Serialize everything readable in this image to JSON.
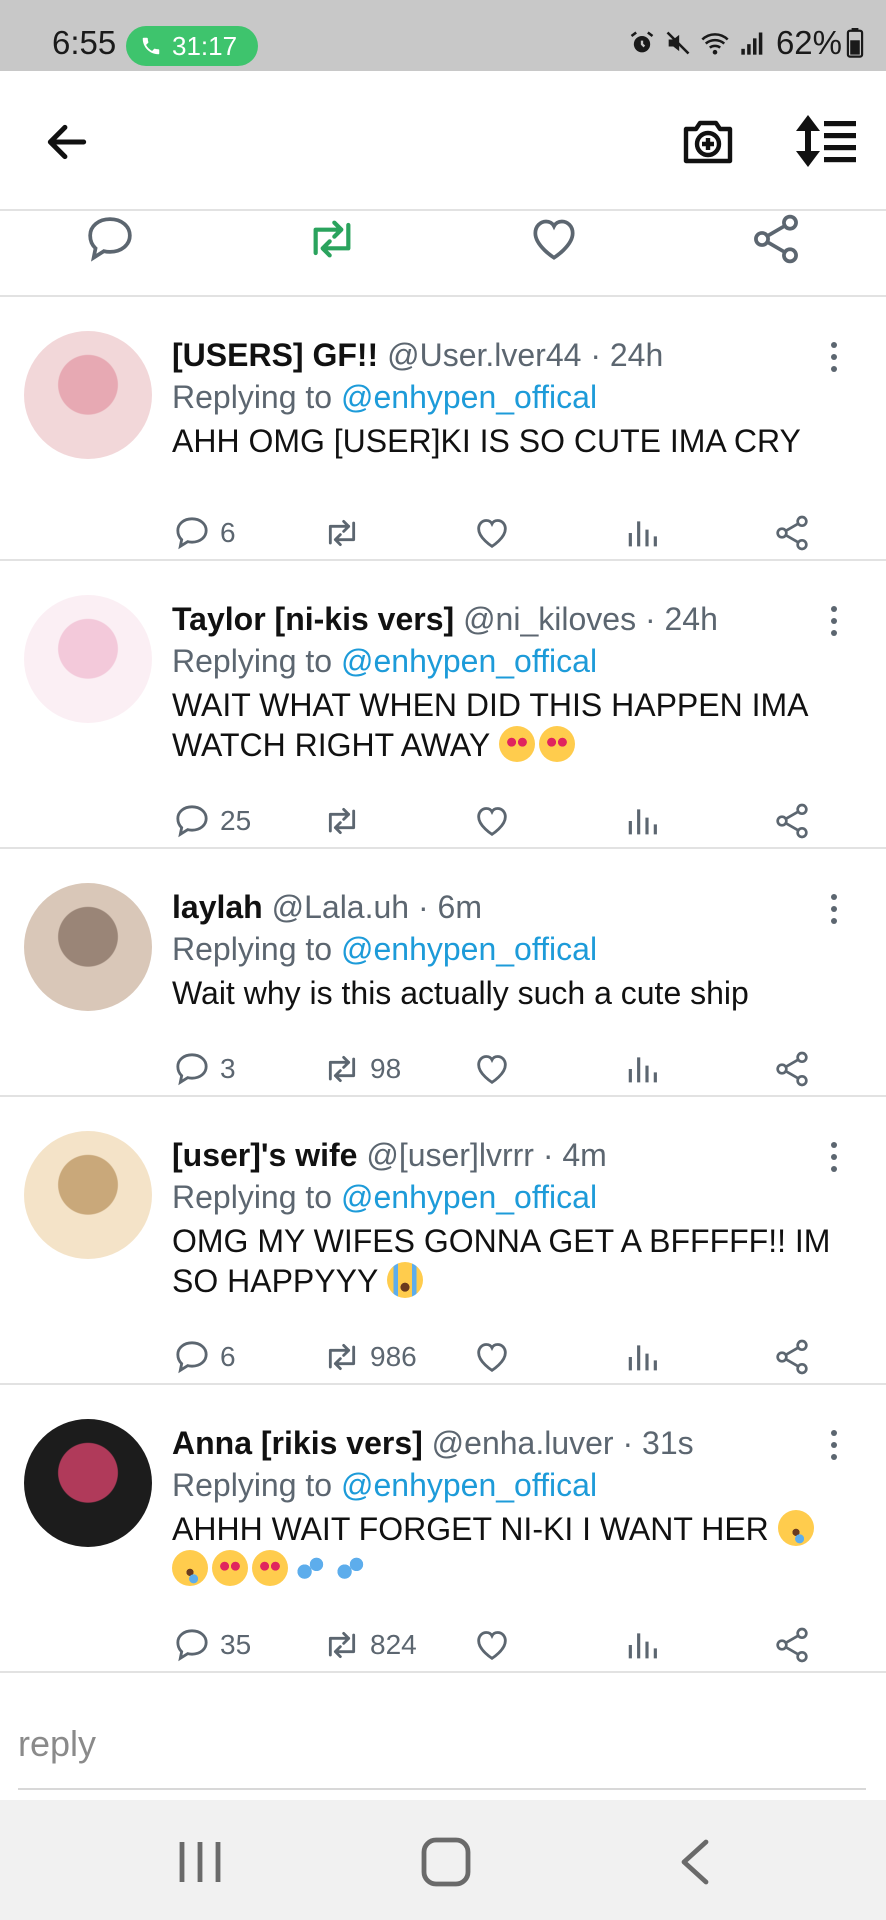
{
  "status_bar": {
    "time": "6:55",
    "call_duration": "31:17",
    "battery": "62%",
    "icons": [
      "alarm-icon",
      "mute-icon",
      "wifi-icon",
      "signal-icon",
      "battery-icon"
    ]
  },
  "app_bar": {
    "icons": [
      "back-arrow-icon",
      "camera-plus-icon",
      "sort-list-icon"
    ]
  },
  "colors": {
    "accent": "#1d9bd9",
    "retweet_green": "#2aa35d",
    "muted": "#5c6670",
    "call_green": "#3ec46d"
  },
  "replies": [
    {
      "display_name": "[USERS] GF!!",
      "handle": "@User.lver44",
      "time": "24h",
      "replying_label": "Replying to",
      "replying_to": "@enhypen_offical",
      "text": "AHH OMG [USER]KI IS SO CUTE IMA CRY",
      "replies": "6",
      "retweets": "",
      "emojis": []
    },
    {
      "display_name": "Taylor [ni-kis vers]",
      "handle": "@ni_kiloves",
      "time": "24h",
      "replying_label": "Replying to",
      "replying_to": "@enhypen_offical",
      "text": "WAIT WHAT WHEN DID THIS HAPPEN IMA WATCH RIGHT AWAY",
      "replies": "25",
      "retweets": "",
      "emojis": [
        "heart-eyes-emoji",
        "heart-eyes-emoji"
      ]
    },
    {
      "display_name": "laylah",
      "handle": "@Lala.uh",
      "time": "6m",
      "replying_label": "Replying to",
      "replying_to": "@enhypen_offical",
      "text": "Wait why is this actually such a cute ship",
      "replies": "3",
      "retweets": "98",
      "emojis": []
    },
    {
      "display_name": "[user]'s wife",
      "handle": "@[user]lvrrr",
      "time": "4m",
      "replying_label": "Replying to",
      "replying_to": "@enhypen_offical",
      "text": "OMG MY WIFES GONNA GET A BFFFFF!! IM SO HAPPYYY",
      "replies": "6",
      "retweets": "986",
      "emojis": [
        "crying-emoji"
      ]
    },
    {
      "display_name": "Anna [rikis vers]",
      "handle": "@enha.luver",
      "time": "31s",
      "replying_label": "Replying to",
      "replying_to": "@enhypen_offical",
      "text": "AHHH WAIT FORGET NI-KI I WANT HER",
      "replies": "35",
      "retweets": "824",
      "emojis": [
        "drooling-emoji",
        "drooling-emoji",
        "heart-eyes-emoji",
        "heart-eyes-emoji",
        "sweat-droplets-emoji",
        "sweat-droplets-emoji"
      ]
    }
  ],
  "reply_input": {
    "placeholder": "reply"
  }
}
